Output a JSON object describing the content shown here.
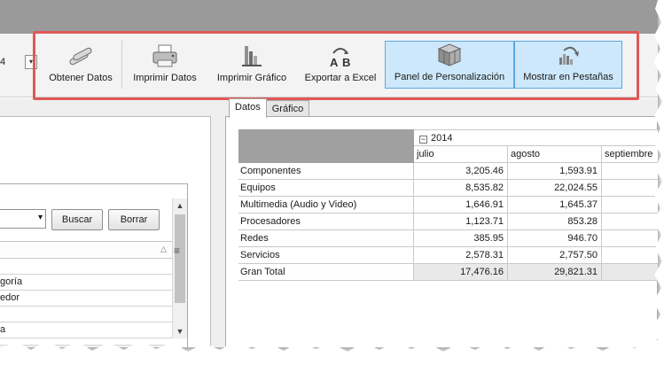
{
  "ribbon": {
    "combo_value": "4",
    "buttons": [
      {
        "label": "Obtener Datos",
        "icon": "pipes-icon"
      },
      {
        "label": "Imprimir Datos",
        "icon": "printer-icon"
      },
      {
        "label": "Imprimir Gráfico",
        "icon": "chart-print-icon"
      },
      {
        "label": "Exportar a Excel",
        "icon": "export-excel-icon"
      },
      {
        "label": "Panel de Personalización",
        "icon": "cubes-icon"
      },
      {
        "label": "Mostrar en Pestañas",
        "icon": "tabs-chart-icon"
      }
    ]
  },
  "filter": {
    "search_label": "Buscar",
    "clear_label": "Borrar",
    "items": [
      "goría",
      "edor",
      "",
      "a"
    ]
  },
  "tabs": [
    "Datos",
    "Gráfico"
  ],
  "pivot": {
    "year": "2014",
    "months": [
      "julio",
      "agosto",
      "septiembre"
    ],
    "rows": [
      {
        "label": "Componentes",
        "values": [
          "3,205.46",
          "1,593.91"
        ]
      },
      {
        "label": "Equipos",
        "values": [
          "8,535.82",
          "22,024.55"
        ]
      },
      {
        "label": "Multimedia (Audio y Video)",
        "values": [
          "1,646.91",
          "1,645.37"
        ]
      },
      {
        "label": "Procesadores",
        "values": [
          "1,123.71",
          "853.28"
        ]
      },
      {
        "label": "Redes",
        "values": [
          "385.95",
          "946.70"
        ]
      },
      {
        "label": "Servicios",
        "values": [
          "2,578.31",
          "2,757.50"
        ]
      }
    ],
    "total": {
      "label": "Gran Total",
      "values": [
        "17,476.16",
        "29,821.31"
      ]
    }
  },
  "colors": {
    "highlight": "#e05858",
    "selected_bg": "#cde8fb",
    "selected_border": "#5aa8de",
    "titlebar": "#9a9a9a"
  }
}
